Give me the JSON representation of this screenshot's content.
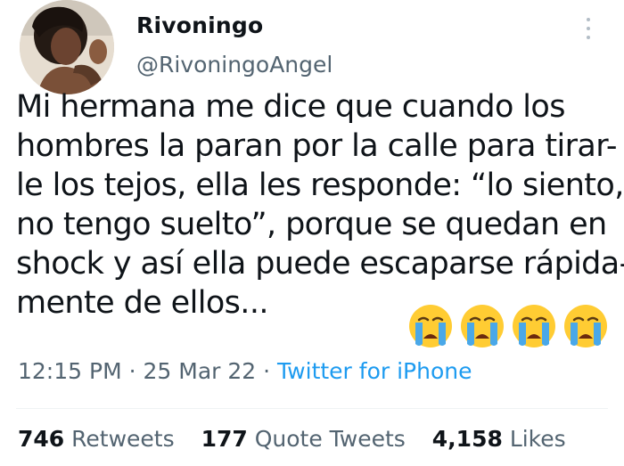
{
  "author": {
    "display_name": "Rivoningo",
    "handle": "@RivoningoAngel"
  },
  "tweet": {
    "lines": [
      "Mi hermana me dice que cuando los",
      "hombres la paran por la calle para tirar-",
      "le los tejos, ella les responde: “lo siento,",
      "no tengo suelto”, porque se quedan en",
      "shock y así ella puede escaparse rápida-",
      "mente de ellos..."
    ],
    "emoji": [
      "crying-face-emoji",
      "crying-face-emoji",
      "crying-face-emoji",
      "crying-face-emoji"
    ]
  },
  "meta": {
    "time": "12:15 PM",
    "separator": "·",
    "date": "25 Mar 22",
    "source": "Twitter for iPhone"
  },
  "stats": {
    "retweets_count": "746",
    "retweets_label": "Retweets",
    "quote_count": "177",
    "quote_label": "Quote Tweets",
    "likes_count": "4,158",
    "likes_label": "Likes"
  },
  "colors": {
    "text": "#0f1419",
    "secondary": "#536471",
    "link": "#1d9bf0",
    "emoji_face": "#ffcc33",
    "tears": "#4aa8e8"
  }
}
